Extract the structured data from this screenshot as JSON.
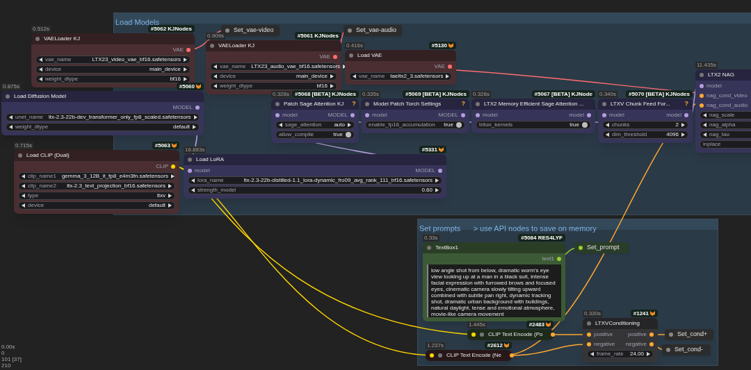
{
  "groups": [
    {
      "title": "Load Models",
      "nodes": [
        {
          "kind": "node",
          "title": "VAELoader KJ",
          "time": "0.512s",
          "badge": "#5062 KJNodes",
          "badge_icon": false,
          "color": "#4a2e31",
          "outputs": [
            {
              "name": "VAE",
              "color": "#ff6e6e"
            }
          ],
          "widgets": [
            {
              "kind": "combo",
              "label": "vae_name",
              "value": "LTX23_video_vae_bf16.safetensors"
            },
            {
              "kind": "combo",
              "label": "device",
              "value": "main_device"
            },
            {
              "kind": "combo",
              "label": "weight_dtype",
              "value": "bf16"
            }
          ]
        },
        {
          "kind": "setter",
          "title": "Set_vae-video",
          "color": "#2c2c2c",
          "inputs": [
            {
              "color": "#888888"
            }
          ]
        },
        {
          "kind": "node",
          "title": "VAELoader KJ",
          "time": "0.909s",
          "badge": "#5061 KJNodes",
          "badge_icon": false,
          "color": "#4a2e31",
          "outputs": [
            {
              "name": "VAE",
              "color": "#ff6e6e"
            }
          ],
          "widgets": [
            {
              "kind": "combo",
              "label": "vae_name",
              "value": "LTX23_audio_vae_bf16.safetensors"
            },
            {
              "kind": "combo",
              "label": "device",
              "value": "main_device"
            },
            {
              "kind": "combo",
              "label": "weight_dtype",
              "value": "bf16"
            }
          ]
        },
        {
          "kind": "setter",
          "title": "Set_vae-audio",
          "color": "#2c2c2c",
          "inputs": [
            {
              "color": "#888888"
            }
          ]
        },
        {
          "kind": "node",
          "title": "Load VAE",
          "time": "0.416s",
          "badge": "#5130",
          "badge_icon": true,
          "color": "#4a2e31",
          "outputs": [
            {
              "name": "VAE",
              "color": "#ff6e6e"
            }
          ],
          "widgets": [
            {
              "kind": "combo",
              "label": "vae_name",
              "value": "taeltx2_3.safetensors"
            }
          ]
        },
        {
          "kind": "node",
          "title": "Load Diffusion Model",
          "time": "0.875s",
          "badge": "#5060",
          "badge_icon": true,
          "color": "#37345a",
          "outputs": [
            {
              "name": "MODEL",
              "color": "#b39ddb"
            }
          ],
          "widgets": [
            {
              "kind": "combo",
              "label": "unet_name",
              "value": "ltx-2.3-22b-dev_transformer_only_fp8_scaled.safetensors"
            },
            {
              "kind": "combo",
              "label": "weight_dtype",
              "value": "default"
            }
          ]
        },
        {
          "kind": "node",
          "title": "Patch Sage Attention KJ",
          "time": "0.328s",
          "badge": "#5068 [BETA] KJNodes",
          "badge_icon": false,
          "help": "?",
          "color": "#37345a",
          "inputs": [
            {
              "name": "model",
              "color": "#b39ddb"
            }
          ],
          "outputs": [
            {
              "name": "MODEL",
              "color": "#b39ddb"
            }
          ],
          "widgets": [
            {
              "kind": "combo",
              "label": "sage_attention",
              "value": "auto"
            },
            {
              "kind": "toggle",
              "label": "allow_compile",
              "value": "true",
              "on": true
            }
          ]
        },
        {
          "kind": "node",
          "title": "Model Patch Torch Settings",
          "time": "0.335s",
          "badge": "#5069 [BETA] KJNodes",
          "badge_icon": false,
          "help": "?",
          "color": "#37345a",
          "inputs": [
            {
              "name": "model",
              "color": "#b39ddb"
            }
          ],
          "outputs": [
            {
              "name": "MODEL",
              "color": "#b39ddb"
            }
          ],
          "widgets": [
            {
              "kind": "toggle",
              "label": "enable_fp16_accumulation",
              "value": "true",
              "on": true
            }
          ]
        },
        {
          "kind": "node",
          "title": "LTX2 Memory Efficient Sage Attention ...",
          "time": "0.328s",
          "badge": "#5067 [BETA] KJNode",
          "badge_icon": false,
          "color": "#37345a",
          "inputs": [
            {
              "name": "model",
              "color": "#b39ddb"
            }
          ],
          "outputs": [
            {
              "name": "model",
              "color": "#b39ddb"
            }
          ],
          "widgets": [
            {
              "kind": "toggle",
              "label": "triton_kernels",
              "value": "true",
              "on": true
            }
          ]
        },
        {
          "kind": "node",
          "title": "LTXV Chunk Feed For...",
          "time": "0.340s",
          "badge": "#5070 [BETA] KJNodes",
          "badge_icon": false,
          "help": "?",
          "color": "#37345a",
          "inputs": [
            {
              "name": "model",
              "color": "#b39ddb"
            }
          ],
          "outputs": [
            {
              "name": "model",
              "color": "#b39ddb"
            }
          ],
          "widgets": [
            {
              "kind": "number",
              "label": "chunks",
              "value": "2"
            },
            {
              "kind": "number",
              "label": "dim_threshold",
              "value": "4096"
            }
          ]
        },
        {
          "kind": "node",
          "title": "LTX2 NAG",
          "time": "11.435s",
          "color": "#37345a",
          "inputs": [
            {
              "name": "model",
              "color": "#b39ddb"
            },
            {
              "name": "nag_cond_video",
              "color": "#ffa931"
            },
            {
              "name": "nag_cond_audio",
              "color": "#ffa931"
            }
          ],
          "widgets": [
            {
              "kind": "number",
              "label": "nag_scale"
            },
            {
              "kind": "number",
              "label": "nag_alpha"
            },
            {
              "kind": "number",
              "label": "nag_tau"
            },
            {
              "kind": "toggle",
              "label": "inplace"
            }
          ]
        },
        {
          "kind": "node",
          "title": "Load CLIP (Dual)",
          "time": "0.715s",
          "badge": "#5063",
          "badge_icon": true,
          "color": "#4a2e31",
          "outputs": [
            {
              "name": "CLIP",
              "color": "#ffd500"
            }
          ],
          "widgets": [
            {
              "kind": "combo",
              "label": "clip_name1",
              "value": "gemma_3_12B_it_fp8_e4m3fn.safetensors"
            },
            {
              "kind": "combo",
              "label": "clip_name2",
              "value": "ltx-2.3_text_projection_bf16.safetensors"
            },
            {
              "kind": "combo",
              "label": "type",
              "value": "ltxv"
            },
            {
              "kind": "combo",
              "label": "device",
              "value": "default"
            }
          ]
        },
        {
          "kind": "node",
          "title": "Load LoRA",
          "time": "16.883s",
          "badge": "#5331",
          "badge_icon": true,
          "color": "#37345a",
          "inputs": [
            {
              "name": "model",
              "color": "#b39ddb"
            }
          ],
          "outputs": [
            {
              "name": "MODEL",
              "color": "#b39ddb"
            }
          ],
          "widgets": [
            {
              "kind": "combo",
              "label": "lora_name",
              "value": "ltx-2.3-22b-distilled-1.1_lora-dynamic_fro09_avg_rank_111_bf16.safetensors"
            },
            {
              "kind": "number",
              "label": "strength_model",
              "value": "0.60"
            }
          ]
        }
      ]
    },
    {
      "title": "Set prompts      > use API nodes to save on memory",
      "nodes": [
        {
          "kind": "textbox",
          "title": "TextBox1",
          "time": "0.33s",
          "badge": "#5084 RES4LYF",
          "badge_icon": false,
          "color": "#3d5a36",
          "outputs": [
            {
              "name": "text1",
              "color": "#9acd32"
            }
          ],
          "text": "low angle shot from below, dramatic worm's eye view looking up at a man in a black suit, intense facial expression with furrowed brows and focused eyes, cinematic camera slowly tilting upward combined with subtle pan right, dynamic tracking shot, dramatic urban background with buildings, natural daylight, tense and emotional atmosphere, movie-like camera movement"
        },
        {
          "kind": "setter",
          "title": "Set_prompt",
          "color": "#2a3d28",
          "inputs": [
            {
              "color": "#9acd32"
            }
          ]
        },
        {
          "kind": "collapsed",
          "title": "CLIP Text Encode (Po",
          "time": "1.445s",
          "badge": "#2483",
          "badge_icon": true,
          "color": "#2a3d28",
          "inputs": [
            {
              "color": "#ffd500"
            }
          ],
          "outputs": [
            {
              "color": "#ffa931"
            }
          ]
        },
        {
          "kind": "collapsed",
          "title": "CLIP Text Encode (Ne",
          "time": "1.237s",
          "badge": "#2612",
          "badge_icon": true,
          "color": "#3a2224",
          "inputs": [
            {
              "color": "#ffd500"
            }
          ],
          "outputs": [
            {
              "color": "#ffa931"
            }
          ]
        },
        {
          "kind": "node",
          "title": "LTXVConditioning",
          "time": "0.330s",
          "badge": "#1241",
          "badge_icon": true,
          "color": "#353538",
          "inputs": [
            {
              "name": "positive",
              "color": "#ffa931"
            },
            {
              "name": "negative",
              "color": "#ffa931"
            }
          ],
          "outputs": [
            {
              "name": "positive",
              "color": "#ffa931"
            },
            {
              "name": "negative",
              "color": "#ffa931"
            }
          ],
          "widgets": [
            {
              "kind": "number",
              "label": "frame_rate",
              "value": "24.00"
            }
          ]
        },
        {
          "kind": "setter",
          "title": "Set_cond+",
          "color": "#2c2c2c",
          "inputs": [
            {
              "color": "#888888"
            }
          ]
        },
        {
          "kind": "setter",
          "title": "Set_cond-",
          "color": "#2c2c2c",
          "inputs": [
            {
              "color": "#888888"
            }
          ]
        }
      ]
    }
  ],
  "stats": [
    "0.00s",
    "0",
    "101 [37]",
    "210"
  ]
}
